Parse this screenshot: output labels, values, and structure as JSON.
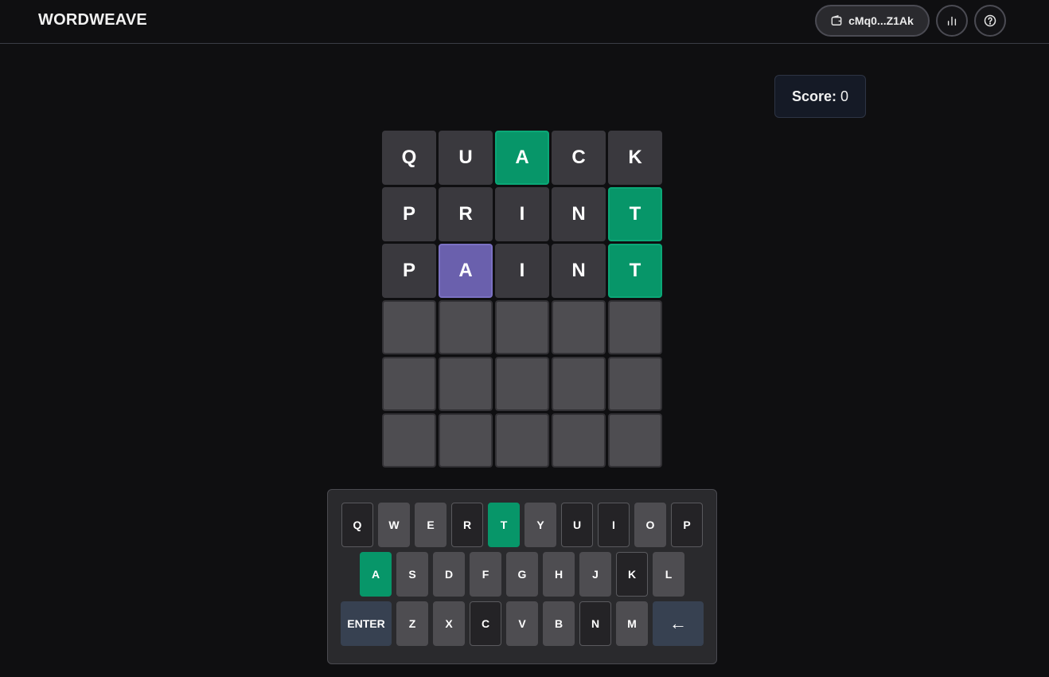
{
  "app": {
    "title": "WORDWEAVE",
    "wallet_label": "cMq0...Z1Ak",
    "stats_icon": "bar-chart-icon",
    "help_icon": "help-circle-icon"
  },
  "score": {
    "label": "Score:",
    "value": "0"
  },
  "colors": {
    "correct": "#079669",
    "present": "#6a60ad",
    "absent": "#3a393e",
    "empty": "#4e4d51",
    "background": "#0f0f11"
  },
  "board": {
    "rows": [
      [
        {
          "letter": "Q",
          "state": "absent"
        },
        {
          "letter": "U",
          "state": "absent"
        },
        {
          "letter": "A",
          "state": "correct"
        },
        {
          "letter": "C",
          "state": "absent"
        },
        {
          "letter": "K",
          "state": "absent"
        }
      ],
      [
        {
          "letter": "P",
          "state": "absent"
        },
        {
          "letter": "R",
          "state": "absent"
        },
        {
          "letter": "I",
          "state": "absent"
        },
        {
          "letter": "N",
          "state": "absent"
        },
        {
          "letter": "T",
          "state": "correct"
        }
      ],
      [
        {
          "letter": "P",
          "state": "absent"
        },
        {
          "letter": "A",
          "state": "present"
        },
        {
          "letter": "I",
          "state": "absent"
        },
        {
          "letter": "N",
          "state": "absent"
        },
        {
          "letter": "T",
          "state": "correct"
        }
      ],
      [
        {
          "letter": "",
          "state": "empty"
        },
        {
          "letter": "",
          "state": "empty"
        },
        {
          "letter": "",
          "state": "empty"
        },
        {
          "letter": "",
          "state": "empty"
        },
        {
          "letter": "",
          "state": "empty"
        }
      ],
      [
        {
          "letter": "",
          "state": "empty"
        },
        {
          "letter": "",
          "state": "empty"
        },
        {
          "letter": "",
          "state": "empty"
        },
        {
          "letter": "",
          "state": "empty"
        },
        {
          "letter": "",
          "state": "empty"
        }
      ],
      [
        {
          "letter": "",
          "state": "empty"
        },
        {
          "letter": "",
          "state": "empty"
        },
        {
          "letter": "",
          "state": "empty"
        },
        {
          "letter": "",
          "state": "empty"
        },
        {
          "letter": "",
          "state": "empty"
        }
      ]
    ]
  },
  "keyboard": {
    "rows": [
      [
        {
          "key": "Q",
          "state": "absent"
        },
        {
          "key": "W",
          "state": "unused"
        },
        {
          "key": "E",
          "state": "unused"
        },
        {
          "key": "R",
          "state": "absent"
        },
        {
          "key": "T",
          "state": "correct"
        },
        {
          "key": "Y",
          "state": "unused"
        },
        {
          "key": "U",
          "state": "absent"
        },
        {
          "key": "I",
          "state": "absent"
        },
        {
          "key": "O",
          "state": "unused"
        },
        {
          "key": "P",
          "state": "absent"
        }
      ],
      [
        {
          "key": "A",
          "state": "correct"
        },
        {
          "key": "S",
          "state": "unused"
        },
        {
          "key": "D",
          "state": "unused"
        },
        {
          "key": "F",
          "state": "unused"
        },
        {
          "key": "G",
          "state": "unused"
        },
        {
          "key": "H",
          "state": "unused"
        },
        {
          "key": "J",
          "state": "unused"
        },
        {
          "key": "K",
          "state": "absent"
        },
        {
          "key": "L",
          "state": "unused"
        }
      ],
      [
        {
          "key": "ENTER",
          "state": "action"
        },
        {
          "key": "Z",
          "state": "unused"
        },
        {
          "key": "X",
          "state": "unused"
        },
        {
          "key": "C",
          "state": "absent"
        },
        {
          "key": "V",
          "state": "unused"
        },
        {
          "key": "B",
          "state": "unused"
        },
        {
          "key": "N",
          "state": "absent"
        },
        {
          "key": "M",
          "state": "unused"
        },
        {
          "key": "←",
          "state": "action"
        }
      ]
    ]
  }
}
